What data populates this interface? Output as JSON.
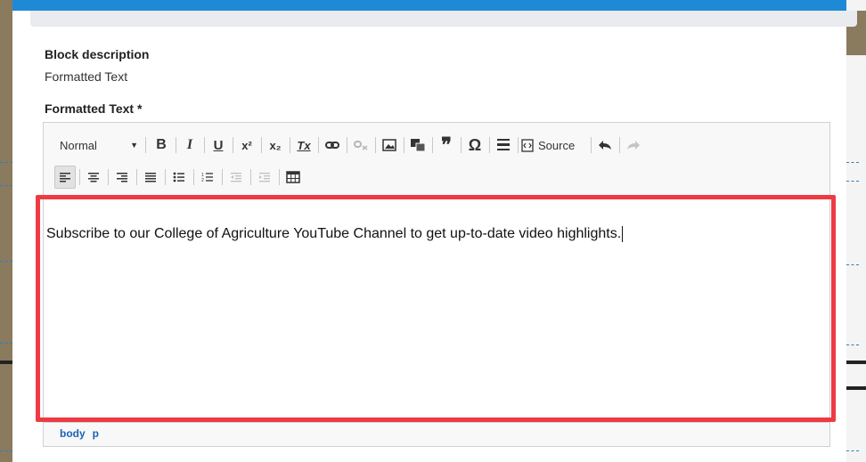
{
  "block_description": {
    "label": "Block description",
    "value": "Formatted Text"
  },
  "formatted_text": {
    "label": "Formatted Text *"
  },
  "toolbar": {
    "format_select": "Normal",
    "bold": "B",
    "italic": "I",
    "underline": "U",
    "superscript": "x²",
    "subscript": "x₂",
    "remove_format": "Tx",
    "source_label": "Source",
    "blockquote": "❞",
    "special_char": "Ω"
  },
  "editor": {
    "content": "Subscribe to our College of Agriculture YouTube Channel to get up-to-date video highlights."
  },
  "element_path": {
    "items": [
      "body",
      "p"
    ]
  },
  "colors": {
    "frame": "#1e8ad6",
    "highlight": "#ee3a43",
    "link": "#1a63b5"
  }
}
